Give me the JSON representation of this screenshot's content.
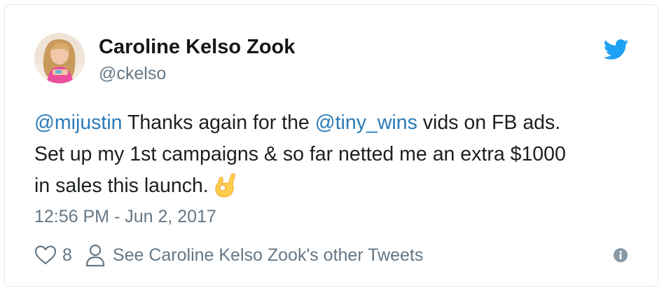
{
  "colors": {
    "accent_link": "#2b7bb9",
    "twitter_blue": "#1da1f2",
    "text_primary": "#14171a",
    "text_secondary": "#657786",
    "border": "#e1e8ed"
  },
  "author": {
    "name": "Caroline Kelso Zook",
    "handle": "@ckelso",
    "avatar_icon": "profile-photo"
  },
  "brand_icon": "twitter-bird-icon",
  "tweet": {
    "line1": {
      "mention1": "@mijustin",
      "text1": " Thanks again for the ",
      "mention2": "@tiny_wins",
      "text2": " vids on FB ads."
    },
    "line2": "Set up my 1st campaigns & so far netted me an extra $1000",
    "line3": "in sales this launch.",
    "emoji": "ok-hand-emoji"
  },
  "timestamp": "12:56 PM - Jun 2, 2017",
  "actions": {
    "like_count": "8",
    "profile_link": "See Caroline Kelso Zook's other Tweets",
    "info_icon": "info-icon"
  }
}
